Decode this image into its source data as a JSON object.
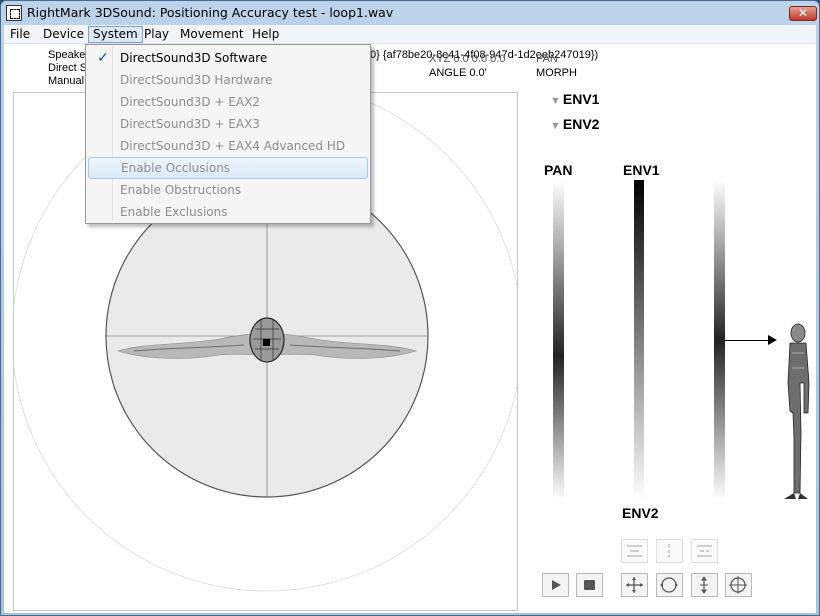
{
  "window": {
    "title": "RightMark 3DSound: Positioning Accuracy test - loop1.wav",
    "close_glyph": "✕"
  },
  "menubar": {
    "items": [
      {
        "label": "File"
      },
      {
        "label": "Device"
      },
      {
        "label": "System"
      },
      {
        "label": "Play"
      },
      {
        "label": "Movement"
      },
      {
        "label": "Help"
      }
    ]
  },
  "info": {
    "line1": "Speake",
    "line2": "Direct S",
    "line3": "Manual",
    "guid": "0} {af78be20-8e41-4f08-947d-1d2eeb247019})",
    "xyz": "XYZ  0.0 0.0 0.0",
    "pan_header": "PAN",
    "angle": "ANGLE  0.0'",
    "morph": "MORPH"
  },
  "env_toggles": {
    "env1": "ENV1",
    "env2": "ENV2",
    "triangle_glyph": "▼"
  },
  "columns": {
    "pan": "PAN",
    "env1": "ENV1",
    "env2": "ENV2"
  },
  "system_menu": {
    "items": [
      {
        "label": "DirectSound3D Software",
        "checked": true,
        "enabled": true
      },
      {
        "label": "DirectSound3D Hardware",
        "enabled": false
      },
      {
        "label": "DirectSound3D + EAX2",
        "enabled": false
      },
      {
        "label": "DirectSound3D + EAX3",
        "enabled": false
      },
      {
        "label": "DirectSound3D + EAX4 Advanced HD",
        "enabled": false
      },
      {
        "label": "Enable Occlusions",
        "enabled": false,
        "highlighted": true
      },
      {
        "label": "Enable Obstructions",
        "enabled": false
      },
      {
        "label": "Enable Exclusions",
        "enabled": false
      }
    ],
    "check_glyph": "✓"
  },
  "colors": {
    "menu_highlight": "#dbe8f5",
    "title_bar": "#bcd3ea",
    "close_button": "#c0392b"
  }
}
